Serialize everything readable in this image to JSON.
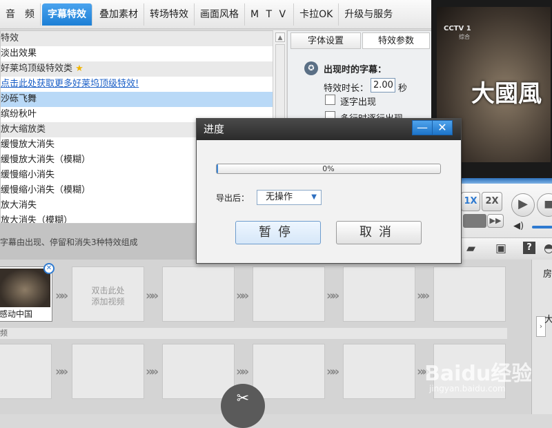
{
  "tabs": [
    "音　频",
    "字幕特效",
    "叠加素材",
    "转场特效",
    "画面风格",
    "M T V",
    "卡拉OK",
    "升级与服务"
  ],
  "active_tab": 1,
  "effects_list": [
    {
      "label": "特效",
      "kind": "cat"
    },
    {
      "label": "淡出效果",
      "kind": "item"
    },
    {
      "label": "好莱坞顶级特效类",
      "kind": "cat",
      "star": true
    },
    {
      "label": "点击此处获取更多好莱坞顶级特效!",
      "kind": "link"
    },
    {
      "label": "沙砾飞舞",
      "kind": "sel"
    },
    {
      "label": "缤纷秋叶",
      "kind": "item"
    },
    {
      "label": "放大缩放类",
      "kind": "cat"
    },
    {
      "label": "缓慢放大消失",
      "kind": "item"
    },
    {
      "label": "缓慢放大消失（模糊）",
      "kind": "item"
    },
    {
      "label": "缓慢缩小消失",
      "kind": "item"
    },
    {
      "label": "缓慢缩小消失（模糊）",
      "kind": "item"
    },
    {
      "label": "放大消失",
      "kind": "item"
    },
    {
      "label": "放大消失（模糊）",
      "kind": "item"
    }
  ],
  "settings": {
    "tab_font": "字体设置",
    "tab_effect": "特效参数",
    "section_title": "出现时的字幕：",
    "duration_label": "特效时长：",
    "duration_value": "2.00",
    "duration_unit": "秒",
    "option1": "逐字出现",
    "option2": "多行时逐行出现"
  },
  "description": "字幕由出现、停留和消失3种特效组成",
  "video": {
    "channel_logo": "CCTV 1",
    "channel_sub": "综合",
    "caption": "大國風"
  },
  "player": {
    "speed_1x": "1X",
    "speed_2x": "2X"
  },
  "timeline": {
    "clip_label": "感动中国",
    "empty_slot_text": "双击此处\n添加视频",
    "track_label": "频"
  },
  "rightbar": {
    "tab1": "房",
    "tab2": "大"
  },
  "dialog": {
    "title": "进度",
    "progress_percent": 0,
    "progress_text": "0%",
    "after_export_label": "导出后：",
    "after_export_value": "无操作",
    "pause": "暂停",
    "cancel": "取消"
  },
  "watermark": {
    "text": "Baidu经验",
    "url": "jingyan.baidu.com"
  }
}
